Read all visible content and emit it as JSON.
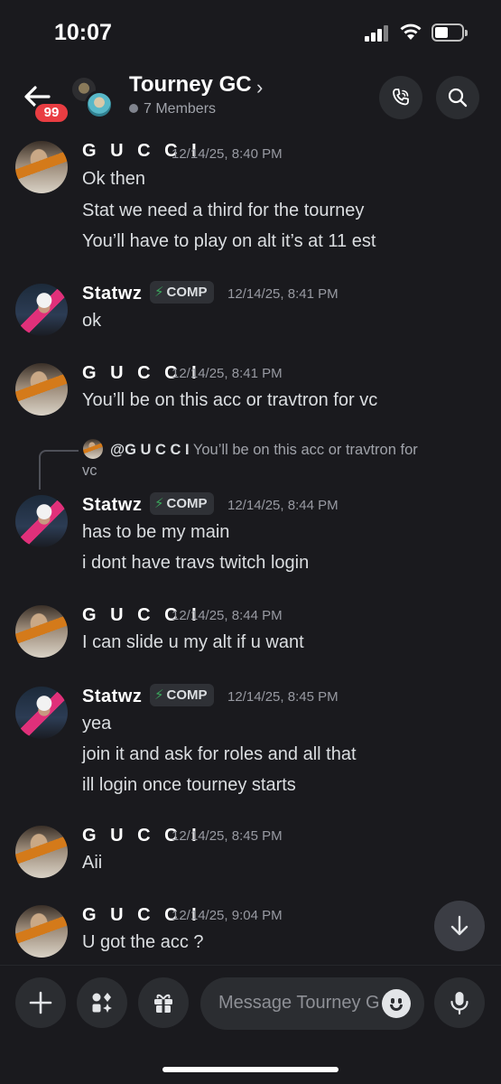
{
  "status_bar": {
    "time": "10:07"
  },
  "header": {
    "back_badge": "99",
    "title": "Tourney GC",
    "chevron": "›",
    "members": "7 Members"
  },
  "messages": [
    {
      "author": "G U C C I",
      "timestamp": "12/14/25, 8:40 PM",
      "lines": [
        "Ok then",
        "Stat we need a third for the tourney",
        "You’ll have to play on alt it’s at 11 est"
      ]
    },
    {
      "author": "Statwz",
      "tag": "COMP",
      "timestamp": "12/14/25, 8:41 PM",
      "lines": [
        "ok"
      ]
    },
    {
      "author": "G U C C I",
      "timestamp": "12/14/25, 8:41 PM",
      "lines": [
        "You’ll be on this acc or travtron for vc"
      ]
    },
    {
      "reply": {
        "mention": "@G U C C I",
        "text": "You’ll be on this acc or travtron for",
        "wrap": "vc"
      },
      "author": "Statwz",
      "tag": "COMP",
      "timestamp": "12/14/25, 8:44 PM",
      "lines": [
        "has to be my main",
        "i dont have travs twitch login"
      ]
    },
    {
      "author": "G U C C I",
      "timestamp": "12/14/25, 8:44 PM",
      "lines": [
        "I can slide u my alt if u want"
      ]
    },
    {
      "author": "Statwz",
      "tag": "COMP",
      "timestamp": "12/14/25, 8:45 PM",
      "lines": [
        "yea",
        "join it and ask for roles and all that",
        "ill login once tourney starts"
      ]
    },
    {
      "author": "G U C C I",
      "timestamp": "12/14/25, 8:45 PM",
      "lines": [
        "Aii"
      ]
    },
    {
      "author": "G U C C I",
      "timestamp": "12/14/25, 9:04 PM",
      "lines": [
        "U got the acc ?"
      ]
    }
  ],
  "composer": {
    "placeholder": "Message Tourney GC"
  },
  "colors": {
    "background": "#1a1a1e",
    "badge": "#e93d42",
    "bolt": "#3ba55c"
  },
  "icons": [
    "back-arrow-icon",
    "call-icon",
    "search-icon",
    "plus-icon",
    "apps-icon",
    "gift-icon",
    "emoji-icon",
    "mic-icon",
    "arrow-down-icon"
  ]
}
